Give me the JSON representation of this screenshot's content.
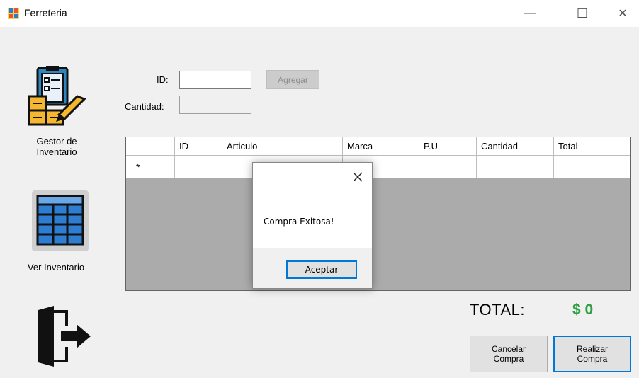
{
  "window": {
    "title": "Ferreteria",
    "minimize": "—",
    "maximize": "☐",
    "close": "✕"
  },
  "sidebar": {
    "inventory_manager_label_1": "Gestor de",
    "inventory_manager_label_2": "Inventario",
    "view_inventory_label": "Ver Inventario"
  },
  "form": {
    "id_label": "ID:",
    "id_value": "",
    "quantity_label": "Cantidad:",
    "quantity_value": "",
    "add_button": "Agregar"
  },
  "grid": {
    "columns": [
      "ID",
      "Articulo",
      "Marca",
      "P.U",
      "Cantidad",
      "Total"
    ],
    "new_row_marker": "*"
  },
  "totals": {
    "label": "TOTAL:",
    "value": "$ 0",
    "value_color": "#2ea043"
  },
  "actions": {
    "cancel_line1": "Cancelar",
    "cancel_line2": "Compra",
    "submit_line1": "Realizar",
    "submit_line2": "Compra"
  },
  "dialog": {
    "message": "Compra Exitosa!",
    "ok_button": "Aceptar"
  },
  "colors": {
    "accent": "#0078d7",
    "grid_bg": "#ababab",
    "window_bg": "#f0f0f0"
  }
}
